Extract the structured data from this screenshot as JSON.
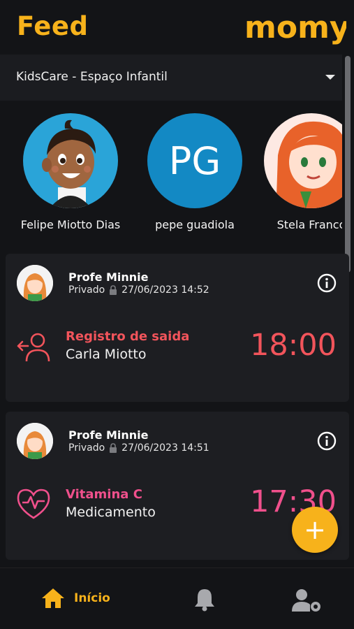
{
  "header": {
    "title": "Feed",
    "logo_text": "momy"
  },
  "school": {
    "name": "KidsCare - Espaço Infantil"
  },
  "children": [
    {
      "name": "Felipe Miotto Dias"
    },
    {
      "name": "pepe guadiola",
      "initials": "PG"
    },
    {
      "name": "Stela Franco"
    }
  ],
  "posts": [
    {
      "teacher": "Profe Minnie",
      "privacy": "Privado",
      "datetime": "27/06/2023 14:52",
      "event_title": "Registro de saida",
      "event_sub": "Carla Miotto",
      "time": "18:00",
      "accent": "#f2545b",
      "icon": "person-exit-icon"
    },
    {
      "teacher": "Profe Minnie",
      "privacy": "Privado",
      "datetime": "27/06/2023 14:51",
      "event_title": "Vitamina C",
      "event_sub": "Medicamento",
      "time": "17:30",
      "accent": "#f0508c",
      "icon": "heart-pulse-icon"
    }
  ],
  "fab": {
    "label": "+"
  },
  "nav": {
    "home_label": "Início"
  },
  "colors": {
    "brand": "#f7b21b",
    "background": "#131417",
    "card": "#1d1e22"
  }
}
